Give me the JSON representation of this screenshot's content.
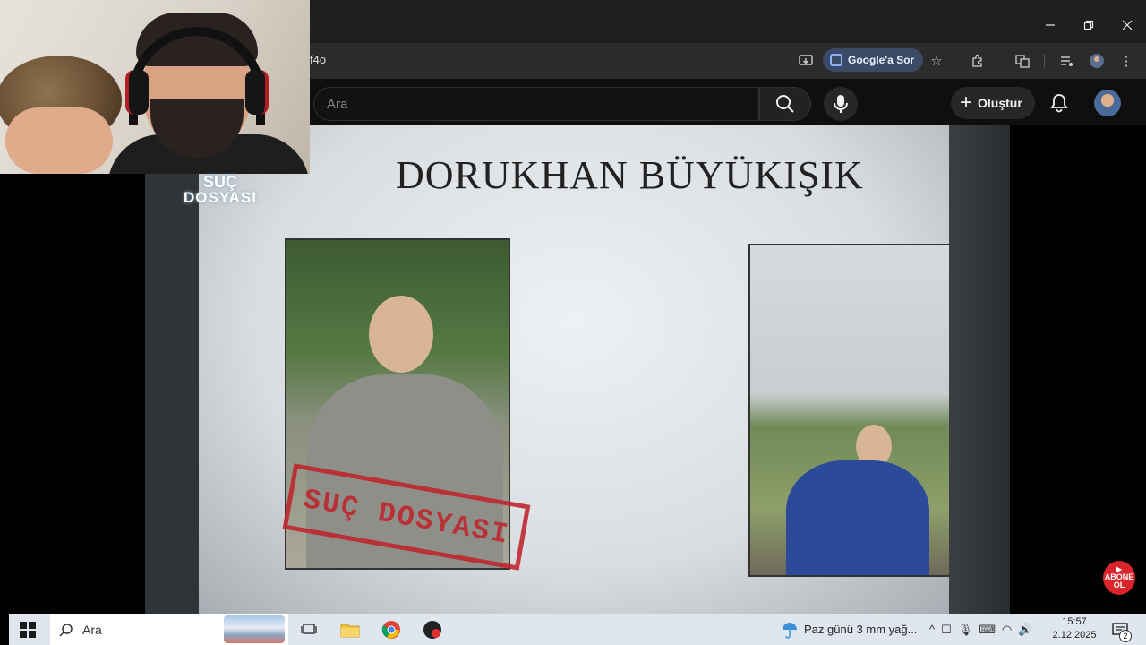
{
  "browser": {
    "url_fragment": "f4o",
    "google_sor_label": "Google'a Sor",
    "window_controls": [
      "minimize-icon",
      "restore-icon",
      "close-icon"
    ]
  },
  "youtube": {
    "search_placeholder": "Ara",
    "create_label": "Oluştur"
  },
  "video": {
    "title": "DORUKHAN BÜYÜKIŞIK",
    "stamp_text": "SUÇ DOSYASI",
    "channel_logo_line1": "SUÇ",
    "channel_logo_line2": "DOSYASI",
    "subscribe_line1": "ABONE",
    "subscribe_line2": "OL"
  },
  "taskbar": {
    "search_placeholder": "Ara",
    "weather_text": "Paz günü 3 mm yağ...",
    "time": "15:57",
    "date": "2.12.2025",
    "notification_count": "2"
  }
}
